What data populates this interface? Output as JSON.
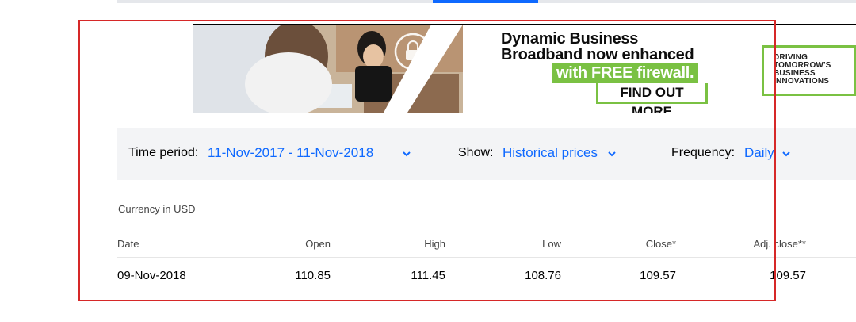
{
  "ad": {
    "headline_line1": "Dynamic Business",
    "headline_line2": "Broadband now enhanced",
    "highlight": "with FREE firewall.",
    "cta": "FIND OUT MORE",
    "tagline": [
      "DRIVING",
      "TOMORROW'S",
      "BUSINESS",
      "INNOVATIONS"
    ],
    "accent_color": "#7ac143"
  },
  "filters": {
    "time_period_label": "Time period:",
    "time_period_value": "11-Nov-2017 - 11-Nov-2018",
    "show_label": "Show:",
    "show_value": "Historical prices",
    "frequency_label": "Frequency:",
    "frequency_value": "Daily",
    "link_color": "#0f69ff"
  },
  "currency_note": "Currency in USD",
  "table": {
    "columns": [
      "Date",
      "Open",
      "High",
      "Low",
      "Close*",
      "Adj. close**"
    ],
    "rows": [
      [
        "09-Nov-2018",
        "110.85",
        "111.45",
        "108.76",
        "109.57",
        "109.57"
      ]
    ]
  }
}
